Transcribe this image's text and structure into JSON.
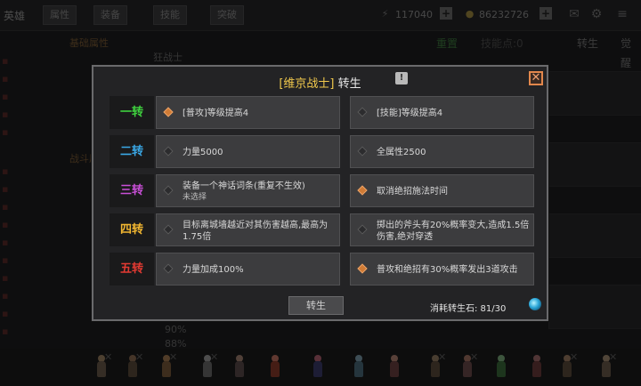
{
  "topbar": {
    "title": "英雄",
    "tabs": [
      "属性",
      "装备",
      "技能",
      "突破"
    ],
    "res1_value": "117040",
    "res2_value": "86232726"
  },
  "background": {
    "left_section_label": "基础属性",
    "left_section_label2": "战斗属性",
    "class_title": "狂战士",
    "right_tabs": [
      "重置",
      "技能点:0",
      "转生",
      "觉醒"
    ],
    "pct1": "90%",
    "pct2": "88%"
  },
  "modal": {
    "class_name": "[维京战士]",
    "title_suffix": "转生",
    "tiers": [
      {
        "label": "一转",
        "color": "#3fd33f",
        "left": {
          "text": "[普攻]等级提高4",
          "sub": "",
          "state": "on"
        },
        "right": {
          "text": "[技能]等级提高4",
          "sub": "",
          "state": "off"
        }
      },
      {
        "label": "二转",
        "color": "#3aa8e6",
        "left": {
          "text": "力量5000",
          "sub": "",
          "state": "off"
        },
        "right": {
          "text": "全属性2500",
          "sub": "",
          "state": "off"
        }
      },
      {
        "label": "三转",
        "color": "#c94fd8",
        "left": {
          "text": "装备一个神话词条(重复不生效)",
          "sub": "未选择",
          "state": "off"
        },
        "right": {
          "text": "取消绝招施法时间",
          "sub": "",
          "state": "on"
        }
      },
      {
        "label": "四转",
        "color": "#f2b731",
        "left": {
          "text": "目标离城墙越近对其伤害越高,最高为1.75倍",
          "sub": "",
          "state": "off"
        },
        "right": {
          "text": "掷出的斧头有20%概率变大,造成1.5倍伤害,绝对穿透",
          "sub": "",
          "state": "off"
        }
      },
      {
        "label": "五转",
        "color": "#e33a32",
        "left": {
          "text": "力量加成100%",
          "sub": "",
          "state": "off"
        },
        "right": {
          "text": "普攻和绝招有30%概率发出3道攻击",
          "sub": "",
          "state": "on"
        }
      }
    ],
    "button_label": "转生",
    "cost_label": "消耗转生石: 81/30"
  }
}
